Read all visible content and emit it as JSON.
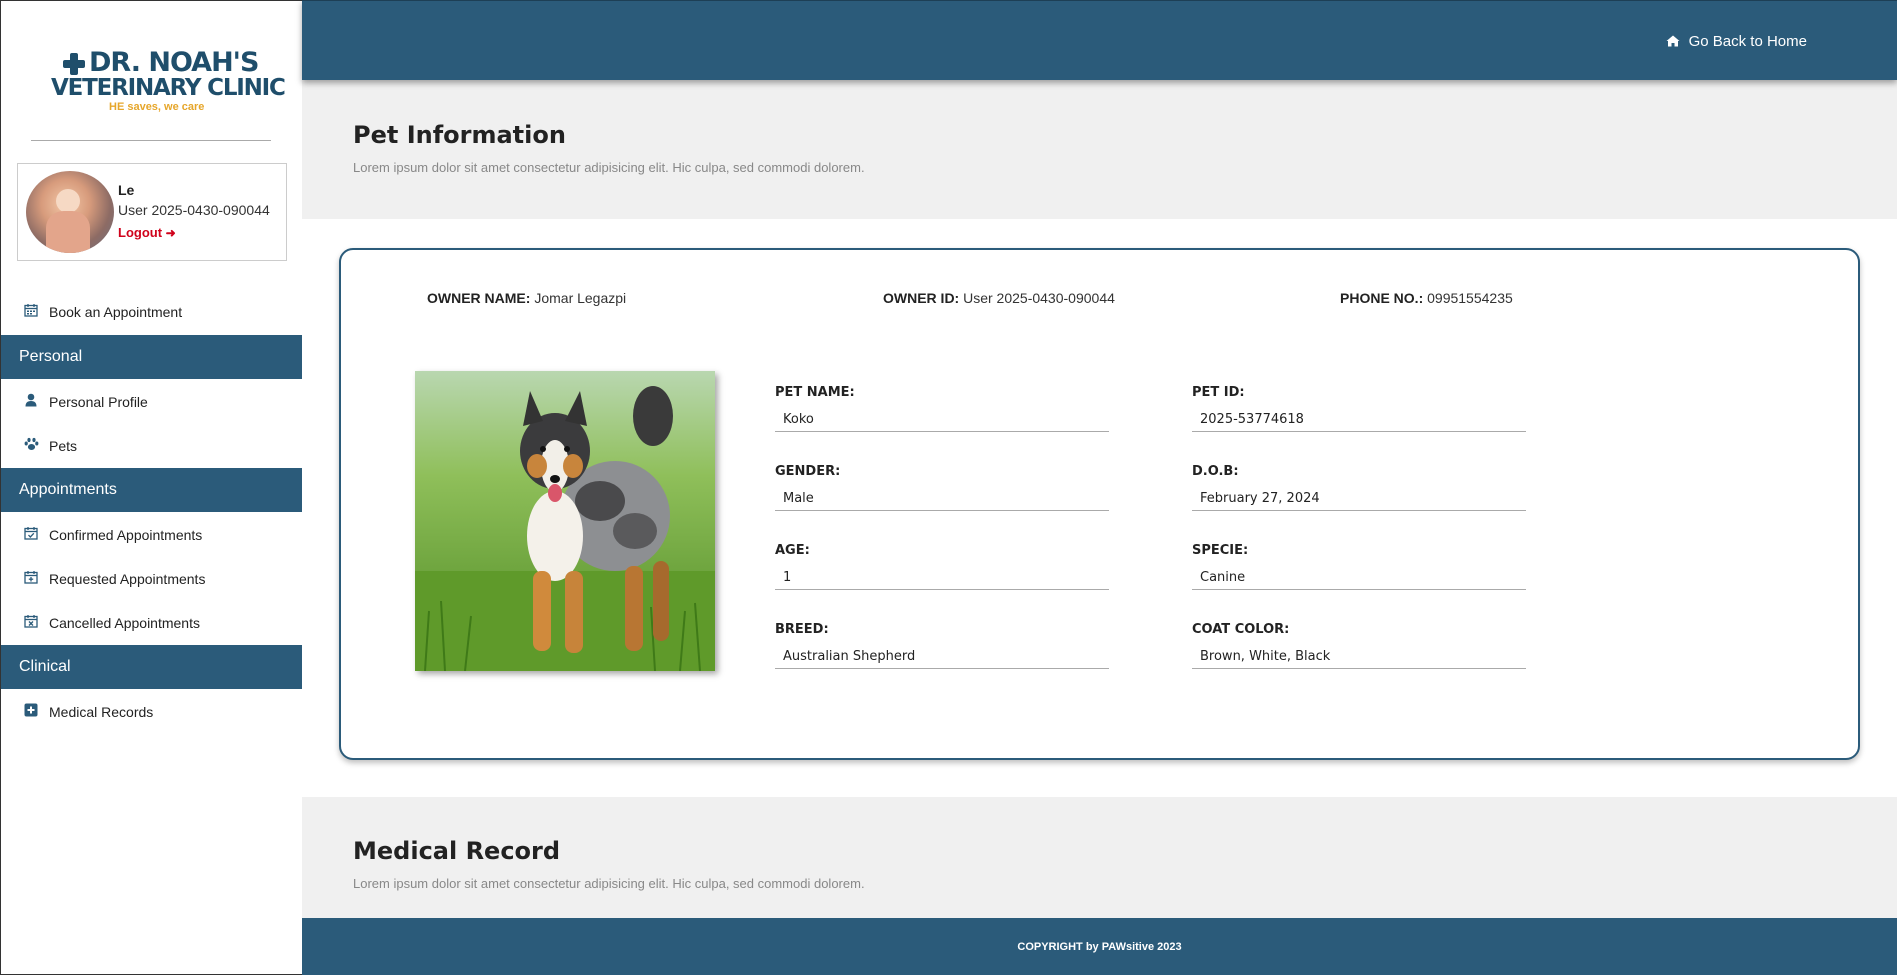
{
  "brand": {
    "line1": "DR. NOAH'S",
    "line2": "VETERINARY CLINIC",
    "tagline": "HE saves, we care"
  },
  "user": {
    "name": "Le",
    "id": "User 2025-0430-090044",
    "logout_label": "Logout"
  },
  "sidebar": {
    "book_label": "Book an Appointment",
    "sections": {
      "personal": "Personal",
      "appointments": "Appointments",
      "clinical": "Clinical"
    },
    "items": {
      "personal_profile": "Personal Profile",
      "pets": "Pets",
      "confirmed": "Confirmed Appointments",
      "requested": "Requested Appointments",
      "cancelled": "Cancelled Appointments",
      "medical_records": "Medical Records"
    }
  },
  "header": {
    "go_home_label": "Go Back to Home"
  },
  "pet_section": {
    "title": "Pet Information",
    "description": "Lorem ipsum dolor sit amet consectetur adipisicing elit. Hic culpa, sed commodi dolorem."
  },
  "owner": {
    "name_label": "OWNER NAME:",
    "name": "Jomar Legazpi",
    "id_label": "OWNER ID:",
    "id": "User 2025-0430-090044",
    "phone_label": "PHONE NO.:",
    "phone": "09951554235"
  },
  "pet": {
    "fields": [
      {
        "label": "PET NAME:",
        "value": "Koko"
      },
      {
        "label": "PET ID:",
        "value": "2025-53774618"
      },
      {
        "label": "GENDER:",
        "value": "Male"
      },
      {
        "label": "D.O.B:",
        "value": "February 27, 2024"
      },
      {
        "label": "AGE:",
        "value": "1"
      },
      {
        "label": "SPECIE:",
        "value": "Canine"
      },
      {
        "label": "BREED:",
        "value": "Australian Shepherd"
      },
      {
        "label": "COAT COLOR:",
        "value": "Brown, White, Black"
      }
    ]
  },
  "medical_section": {
    "title": "Medical Record",
    "description": "Lorem ipsum dolor sit amet consectetur adipisicing elit. Hic culpa, sed commodi dolorem."
  },
  "footer": {
    "text": "COPYRIGHT by PAWsitive 2023"
  },
  "colors": {
    "primary": "#2b5b7a",
    "logout": "#d0021b",
    "tagline": "#e6a62a"
  },
  "icons": [
    "calendar-icon",
    "user-icon",
    "paw-icon",
    "calendar-check-icon",
    "calendar-plus-icon",
    "calendar-x-icon",
    "plus-square-icon",
    "home-icon",
    "logout-icon"
  ]
}
